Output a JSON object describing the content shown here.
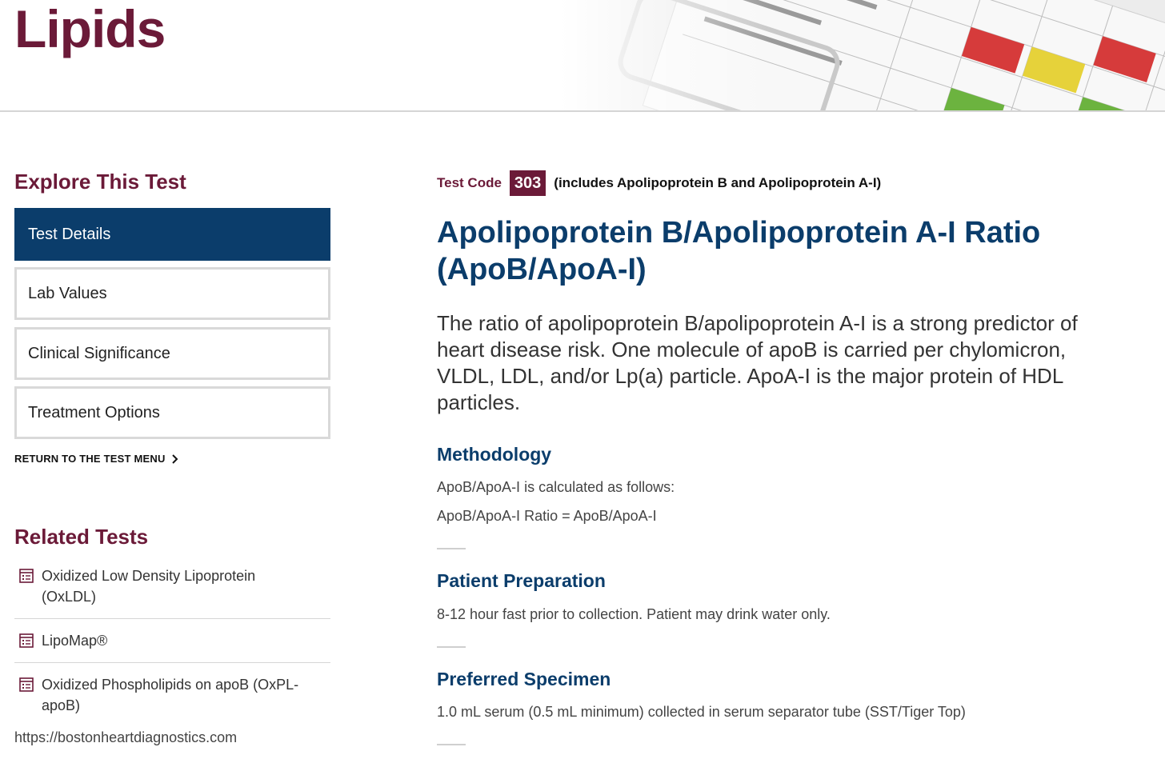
{
  "header": {
    "title": "Lipids"
  },
  "sidebar": {
    "explore_heading": "Explore This Test",
    "nav_items": [
      {
        "label": "Test Details",
        "active": true
      },
      {
        "label": "Lab Values",
        "active": false
      },
      {
        "label": "Clinical Significance",
        "active": false
      },
      {
        "label": "Treatment Options",
        "active": false
      }
    ],
    "return_link": "RETURN TO THE TEST MENU",
    "related_heading": "Related Tests",
    "related_items": [
      {
        "label": "Oxidized Low Density Lipoprotein (OxLDL)",
        "icon": "document-list-icon"
      },
      {
        "label": "LipoMap®",
        "icon": "document-list-icon"
      },
      {
        "label": "Oxidized Phospholipids on apoB (OxPL-apoB)",
        "icon": "document-list-icon"
      }
    ],
    "url": "https://bostonheartdiagnostics.com"
  },
  "main": {
    "test_code_label": "Test Code",
    "test_code": "303",
    "test_code_note": "(includes Apolipoprotein B and Apolipoprotein A-I)",
    "title": "Apolipoprotein B/Apolipoprotein A-I Ratio (ApoB/ApoA-I)",
    "lead": "The ratio of apolipoprotein B/apolipoprotein A-I is a strong predictor of heart disease risk. One molecule of apoB is carried per chylomicron, VLDL, LDL, and/or Lp(a) particle. ApoA-I is the major protein of HDL particles.",
    "sections": [
      {
        "heading": "Methodology",
        "lines": [
          "ApoB/ApoA-I is  calculated as follows:",
          "ApoB/ApoA-I Ratio = ApoB/ApoA-I"
        ]
      },
      {
        "heading": "Patient Preparation",
        "lines": [
          "8-12 hour fast prior to collection.  Patient may drink water only."
        ]
      },
      {
        "heading": "Preferred Specimen",
        "lines": [
          "1.0 mL serum (0.5 mL minimum) collected in serum separator tube (SST/Tiger Top)"
        ]
      }
    ]
  },
  "colors": {
    "brand_maroon": "#6b1a38",
    "brand_navy": "#0b3d6b"
  }
}
